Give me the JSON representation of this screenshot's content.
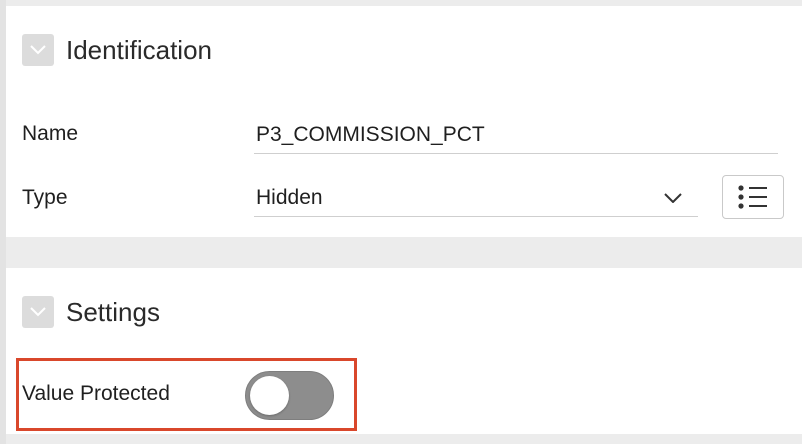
{
  "identification": {
    "title": "Identification",
    "name_label": "Name",
    "name_value": "P3_COMMISSION_PCT",
    "type_label": "Type",
    "type_value": "Hidden"
  },
  "settings": {
    "title": "Settings",
    "value_protected_label": "Value Protected",
    "value_protected_on": false
  },
  "colors": {
    "highlight": "#d9472b",
    "toggle_off": "#8d8d8d"
  },
  "icons": {
    "collapse": "chevron-down-icon",
    "select": "chevron-down-icon",
    "list": "list-icon"
  }
}
